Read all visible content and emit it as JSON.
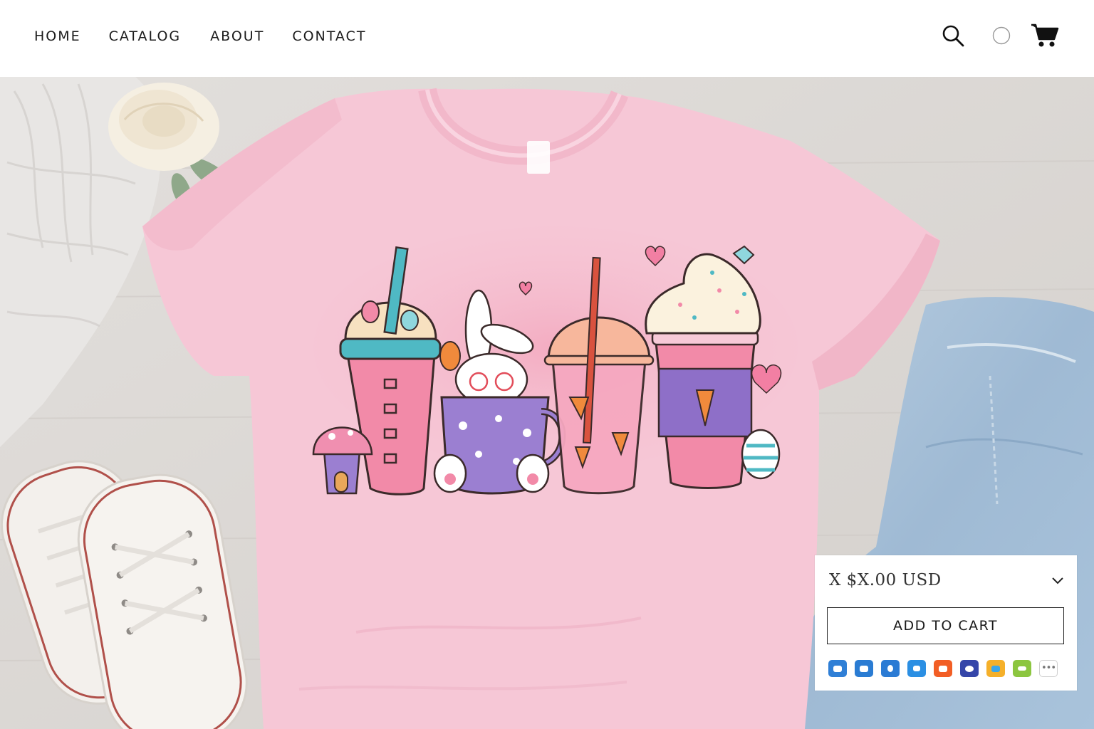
{
  "nav": {
    "home": "HOME",
    "catalog": "CATALOG",
    "about": "ABOUT",
    "contact": "CONTACT"
  },
  "header_icons": [
    "search-icon",
    "account-icon",
    "cart-icon"
  ],
  "product": {
    "price": "X $X.00 USD",
    "add_to_cart": "ADD TO CART"
  },
  "share_icons": [
    {
      "name": "share-icon-1",
      "color": "#2f7fd6"
    },
    {
      "name": "share-icon-2",
      "color": "#2a7cd3"
    },
    {
      "name": "share-icon-3",
      "color": "#2b7bd4"
    },
    {
      "name": "share-icon-4",
      "color": "#2b8fe3"
    },
    {
      "name": "share-icon-5",
      "color": "#f25e25"
    },
    {
      "name": "share-icon-6",
      "color": "#3546a9"
    },
    {
      "name": "share-icon-7",
      "color": "#f5b02a"
    },
    {
      "name": "share-icon-8",
      "color": "#8cc63f"
    }
  ],
  "colors": {
    "shirt": "#f6c7d6",
    "floor": "#dcd8d5",
    "denim": "#a8c2da",
    "text": "#1b1b1b"
  }
}
